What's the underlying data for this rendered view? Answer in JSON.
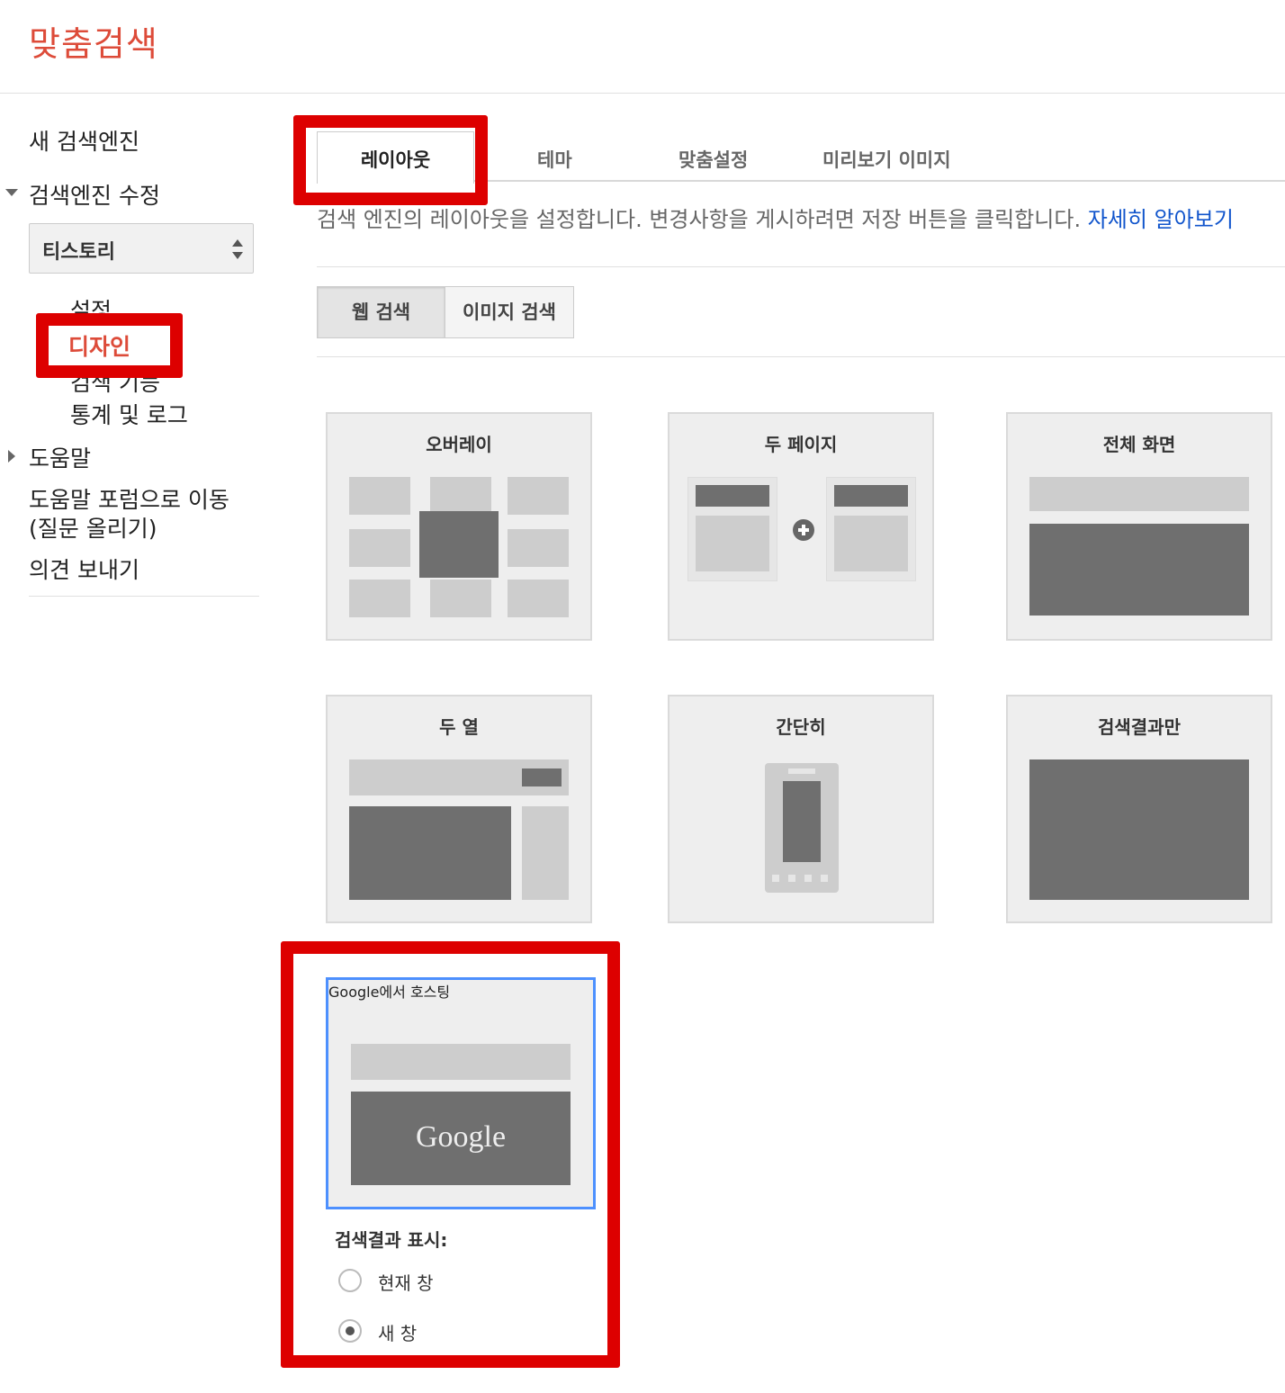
{
  "app_title": "맞춤검색",
  "sidebar": {
    "new_engine": "새 검색엔진",
    "edit_engine": "검색엔진 수정",
    "engine_select_value": "티스토리",
    "sub_items": [
      "설정",
      "디자인",
      "검색 기능",
      "통계 및 로그"
    ],
    "help": "도움말",
    "forum_line1": "도움말 포럼으로 이동",
    "forum_line2": "(질문 올리기)",
    "feedback": "의견 보내기"
  },
  "tabs": [
    "레이아웃",
    "테마",
    "맞춤설정",
    "미리보기 이미지"
  ],
  "description": {
    "text": "검색 엔진의 레이아웃을 설정합니다. 변경사항을 게시하려면 저장 버튼을 클릭합니다. ",
    "link": "자세히 알아보기"
  },
  "search_types": [
    "웹 검색",
    "이미지 검색"
  ],
  "layouts": [
    "오버레이",
    "두 페이지",
    "전체 화면",
    "두 열",
    "간단히",
    "검색결과만",
    "Google에서 호스팅"
  ],
  "google_logo": "Google",
  "results_display": {
    "label": "검색결과 표시:",
    "options": [
      "현재 창",
      "새 창"
    ],
    "selected": "새 창"
  },
  "colors": {
    "accent": "#dd4b39",
    "highlight": "#dd0000",
    "link": "#1155cc",
    "selected_border": "#4d90fe"
  }
}
